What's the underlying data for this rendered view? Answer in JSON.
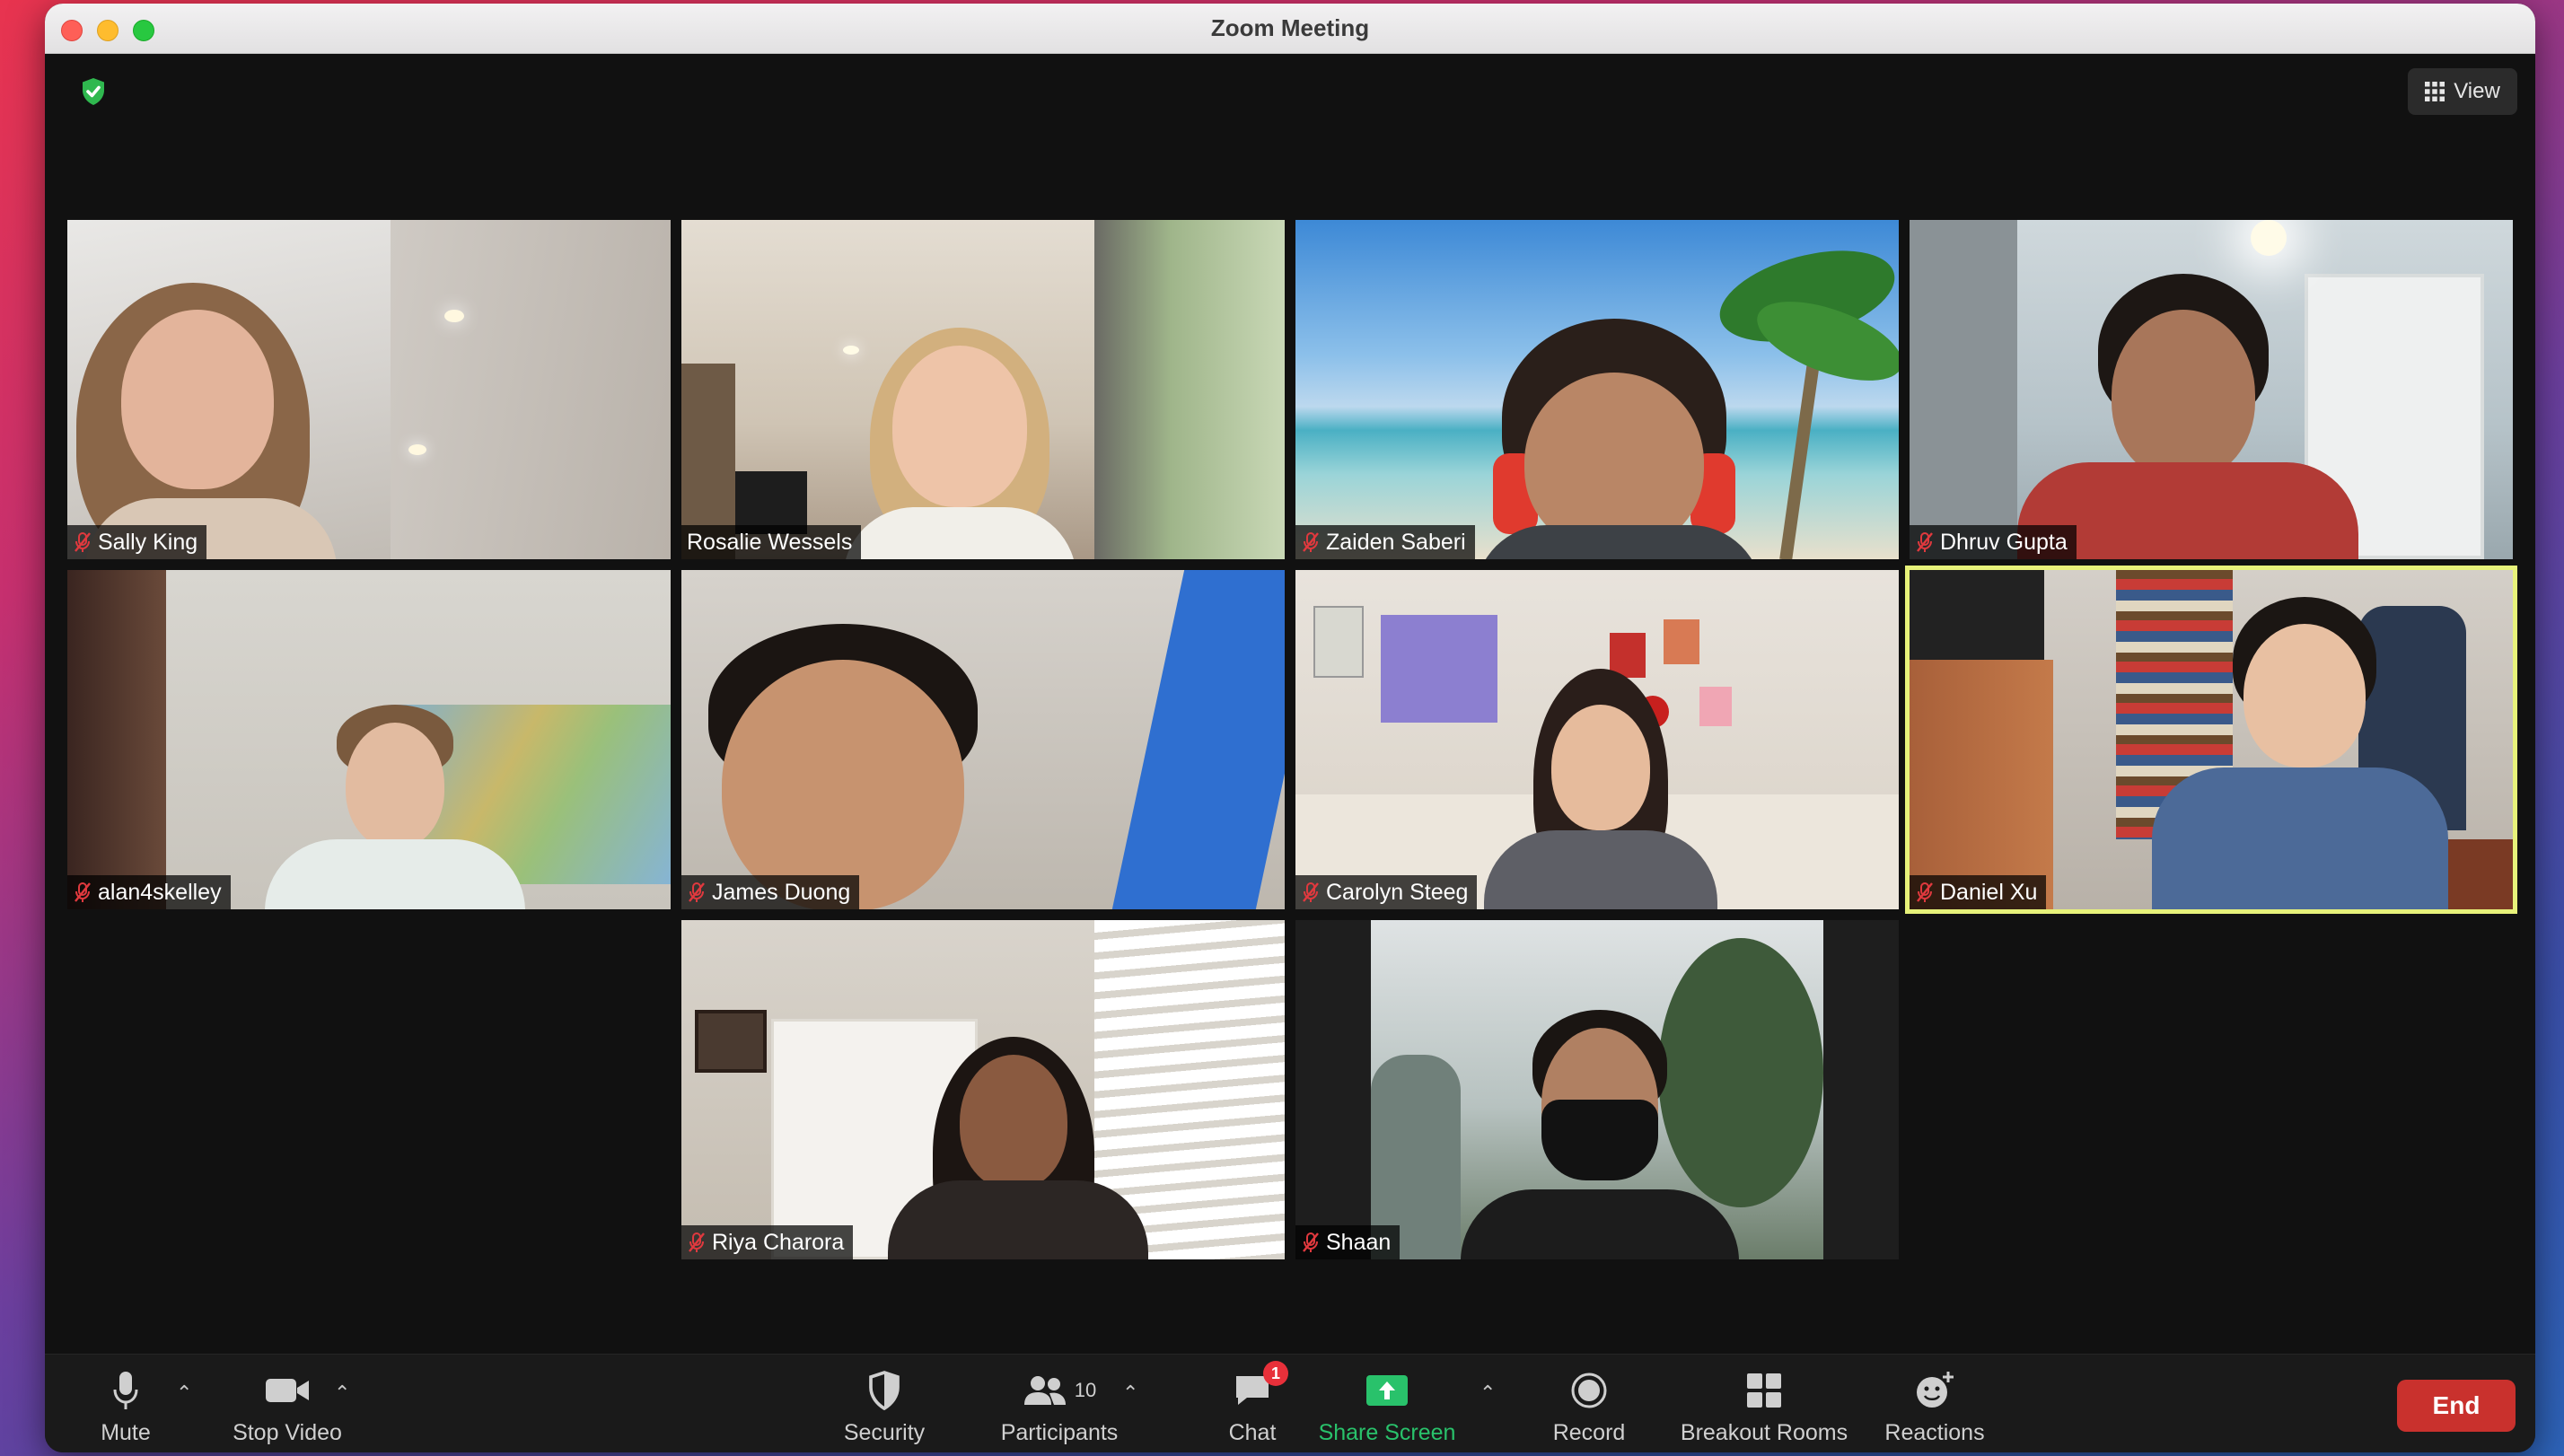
{
  "window": {
    "title": "Zoom Meeting"
  },
  "header": {
    "view_label": "View",
    "security_icon": "shield-check-icon",
    "security_color": "#2fb84f"
  },
  "participants": [
    {
      "name": "Sally King",
      "muted": true,
      "active_speaker": false
    },
    {
      "name": "Rosalie Wessels",
      "muted": false,
      "active_speaker": false
    },
    {
      "name": "Zaiden Saberi",
      "muted": true,
      "active_speaker": false
    },
    {
      "name": "Dhruv Gupta",
      "muted": true,
      "active_speaker": false
    },
    {
      "name": "alan4skelley",
      "muted": true,
      "active_speaker": false
    },
    {
      "name": "James Duong",
      "muted": true,
      "active_speaker": false
    },
    {
      "name": "Carolyn Steeg",
      "muted": true,
      "active_speaker": false
    },
    {
      "name": "Daniel Xu",
      "muted": true,
      "active_speaker": true
    },
    {
      "name": "Riya Charora",
      "muted": true,
      "active_speaker": false
    },
    {
      "name": "Shaan",
      "muted": true,
      "active_speaker": false
    }
  ],
  "toolbar": {
    "mute_label": "Mute",
    "stop_video_label": "Stop Video",
    "security_label": "Security",
    "participants_label": "Participants",
    "participants_count": "10",
    "chat_label": "Chat",
    "chat_badge": "1",
    "share_screen_label": "Share Screen",
    "record_label": "Record",
    "breakout_rooms_label": "Breakout Rooms",
    "reactions_label": "Reactions",
    "end_label": "End"
  },
  "colors": {
    "active_speaker_border": "#e7f27a",
    "share_screen_green": "#29c26b",
    "end_red": "#c9312d",
    "muted_red": "#e0393e",
    "chat_badge_red": "#e8303a"
  }
}
